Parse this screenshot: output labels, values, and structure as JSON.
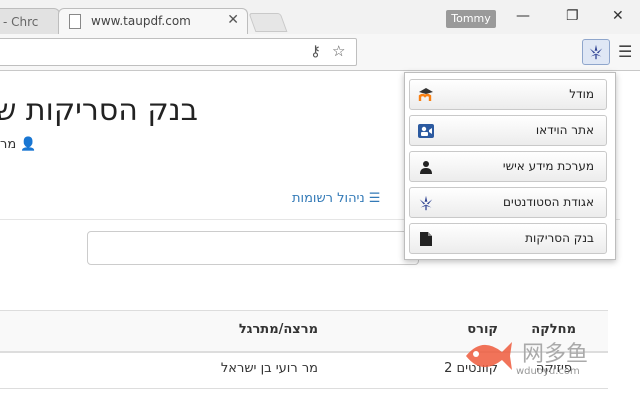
{
  "browser": {
    "prev_tab_title": "- Chrc",
    "active_tab_title": "www.taupdf.com",
    "profile_name": "Tommy",
    "accent": "#3355aa"
  },
  "page": {
    "title": "בנק הסריקות ש",
    "user_text": "מר",
    "manage_lists_label": "ניהול רשומות",
    "table": {
      "headers": {
        "department": "מחלקה",
        "course": "קורס",
        "lecturer": "מרצה/מתרגל"
      },
      "rows": [
        {
          "department": "פיזיקה",
          "course": "קוונטים 2",
          "lecturer": "מר רועי בן ישראל"
        }
      ]
    }
  },
  "popup": {
    "items": [
      {
        "label": "מודל",
        "icon": "moodle-icon"
      },
      {
        "label": "אתר הוידאו",
        "icon": "video-icon"
      },
      {
        "label": "מערכת מידע אישי",
        "icon": "person-icon"
      },
      {
        "label": "אגודת הסטודנטים",
        "icon": "tau-logo-icon"
      },
      {
        "label": "בנק הסריקות",
        "icon": "file-icon"
      }
    ]
  },
  "watermark": {
    "title": "网多鱼",
    "subtitle": "wduoyu.com"
  }
}
